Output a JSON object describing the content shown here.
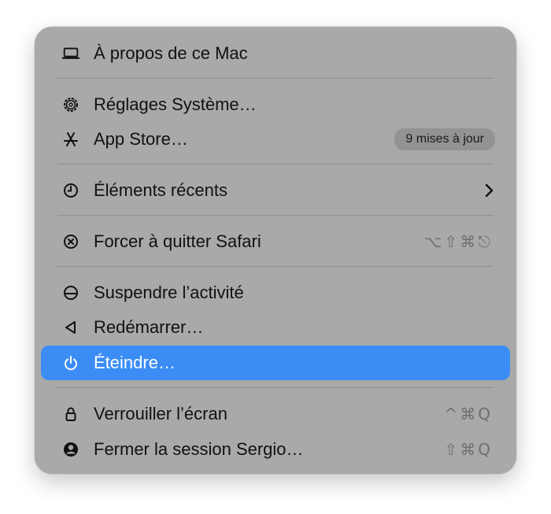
{
  "menu": {
    "about": {
      "label": "À propos de ce Mac",
      "icon": "laptop-icon"
    },
    "settings": {
      "label": "Réglages Système…",
      "icon": "gear-icon"
    },
    "app_store": {
      "label": "App Store…",
      "icon": "app-store-icon",
      "badge": "9 mises à jour"
    },
    "recent": {
      "label": "Éléments récents",
      "icon": "clock-icon",
      "submenu_icon": "chevron-right-icon"
    },
    "force_quit": {
      "label": "Forcer à quitter Safari",
      "icon": "force-quit-icon",
      "shortcut": "⌥⇧⌘⎋"
    },
    "sleep": {
      "label": "Suspendre l’activité",
      "icon": "sleep-icon"
    },
    "restart": {
      "label": "Redémarrer…",
      "icon": "restart-icon"
    },
    "shutdown": {
      "label": "Éteindre…",
      "icon": "power-icon",
      "selected": true
    },
    "lock": {
      "label": "Verrouiller l’écran",
      "icon": "lock-icon",
      "shortcut": "^⌘Q"
    },
    "logout": {
      "label": "Fermer la session Sergio…",
      "icon": "user-icon",
      "shortcut": "⇧⌘Q"
    }
  },
  "colors": {
    "menu_background": "#a9a9a9",
    "selection": "#3b8df5",
    "text": "#111111",
    "shortcut_text": "#6f6f6f",
    "badge_background": "#939393"
  }
}
